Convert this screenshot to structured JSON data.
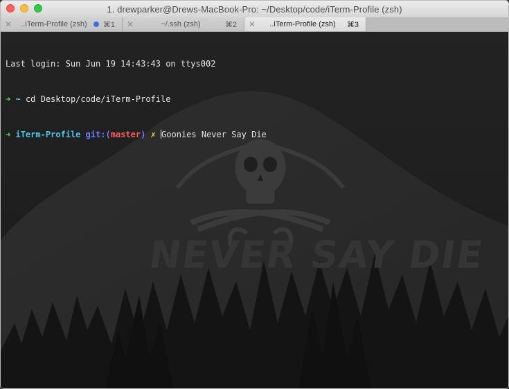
{
  "window": {
    "title": "1. drewparker@Drews-MacBook-Pro: ~/Desktop/code/iTerm-Profile (zsh)"
  },
  "tabs": [
    {
      "label": "..iTerm-Profile (zsh)",
      "shortcut": "⌘1",
      "has_activity_dot": true,
      "active": false
    },
    {
      "label": "~/.ssh (zsh)",
      "shortcut": "⌘2",
      "has_activity_dot": false,
      "active": false
    },
    {
      "label": "..iTerm-Profile (zsh)",
      "shortcut": "⌘3",
      "has_activity_dot": false,
      "active": true
    }
  ],
  "terminal": {
    "last_login": "Last login: Sun Jun 19 14:43:43 on ttys002",
    "line2": {
      "arrow": "➜",
      "dir": "~",
      "command": "cd Desktop/code/iTerm-Profile"
    },
    "line3": {
      "arrow": "➜",
      "dir": "iTerm-Profile",
      "git_label": "git:(",
      "branch": "master",
      "git_close": ")",
      "dirty_mark": "✗",
      "input": "Goonies Never Say Die"
    }
  },
  "background": {
    "watermark_text": "NEVER SAY DIE",
    "icon": "skull-crossbones-icon"
  },
  "colors": {
    "prompt_arrow": "#4ee04a",
    "dir": "#4fc3e8",
    "git": "#6f7dff",
    "branch": "#ff5c5c",
    "dirty": "#ffd34a",
    "tab_dot": "#3d6cf0"
  }
}
